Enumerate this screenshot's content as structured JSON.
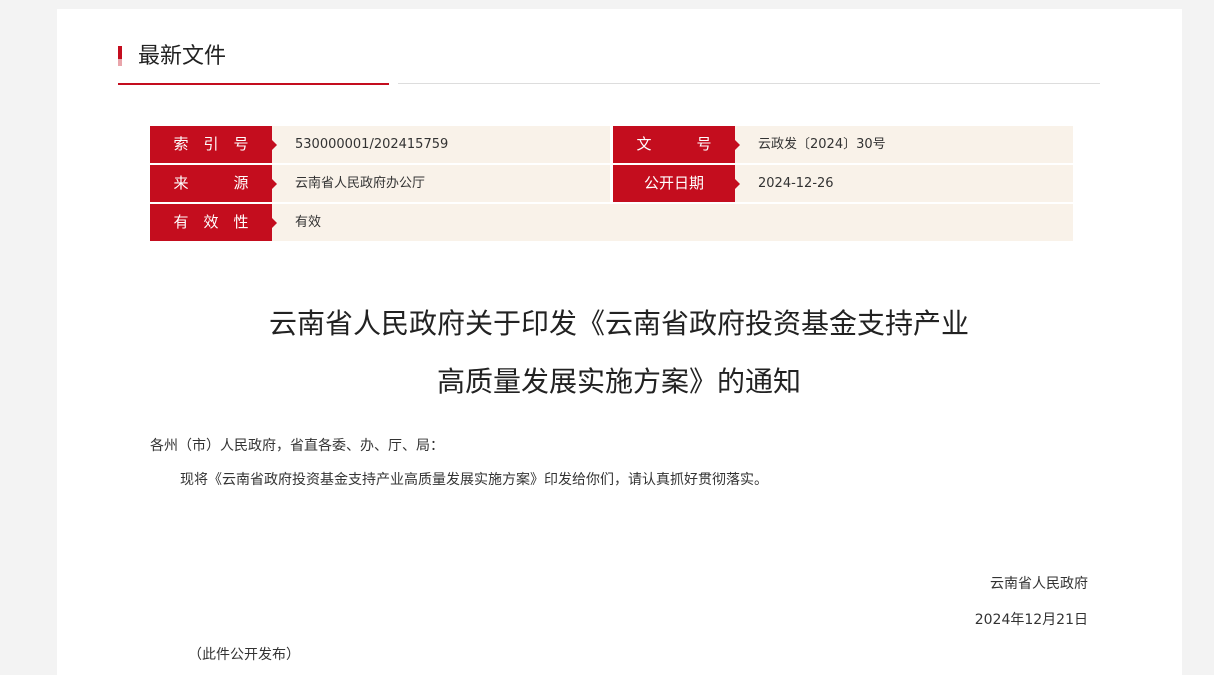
{
  "section": {
    "title": "最新文件"
  },
  "meta": {
    "index_label": "索　引　号",
    "index_value": "530000001/202415759",
    "doc_no_label": "文　　　号",
    "doc_no_value": "云政发〔2024〕30号",
    "source_label": "来　　　源",
    "source_value": "云南省人民政府办公厅",
    "publish_date_label": "公开日期",
    "publish_date_value": "2024-12-26",
    "validity_label": "有　效　性",
    "validity_value": "有效"
  },
  "document": {
    "title_line1": "云南省人民政府关于印发《云南省政府投资基金支持产业",
    "title_line2": "高质量发展实施方案》的通知",
    "addressee": "各州（市）人民政府，省直各委、办、厅、局：",
    "body": "现将《云南省政府投资基金支持产业高质量发展实施方案》印发给你们，请认真抓好贯彻落实。",
    "signature_org": "云南省人民政府",
    "signature_date": "2024年12月21日",
    "publication_note": "（此件公开发布）"
  },
  "colors": {
    "accent": "#c40d1e",
    "meta_background": "#f9f2e9",
    "page_background": "#f3f3f3"
  }
}
